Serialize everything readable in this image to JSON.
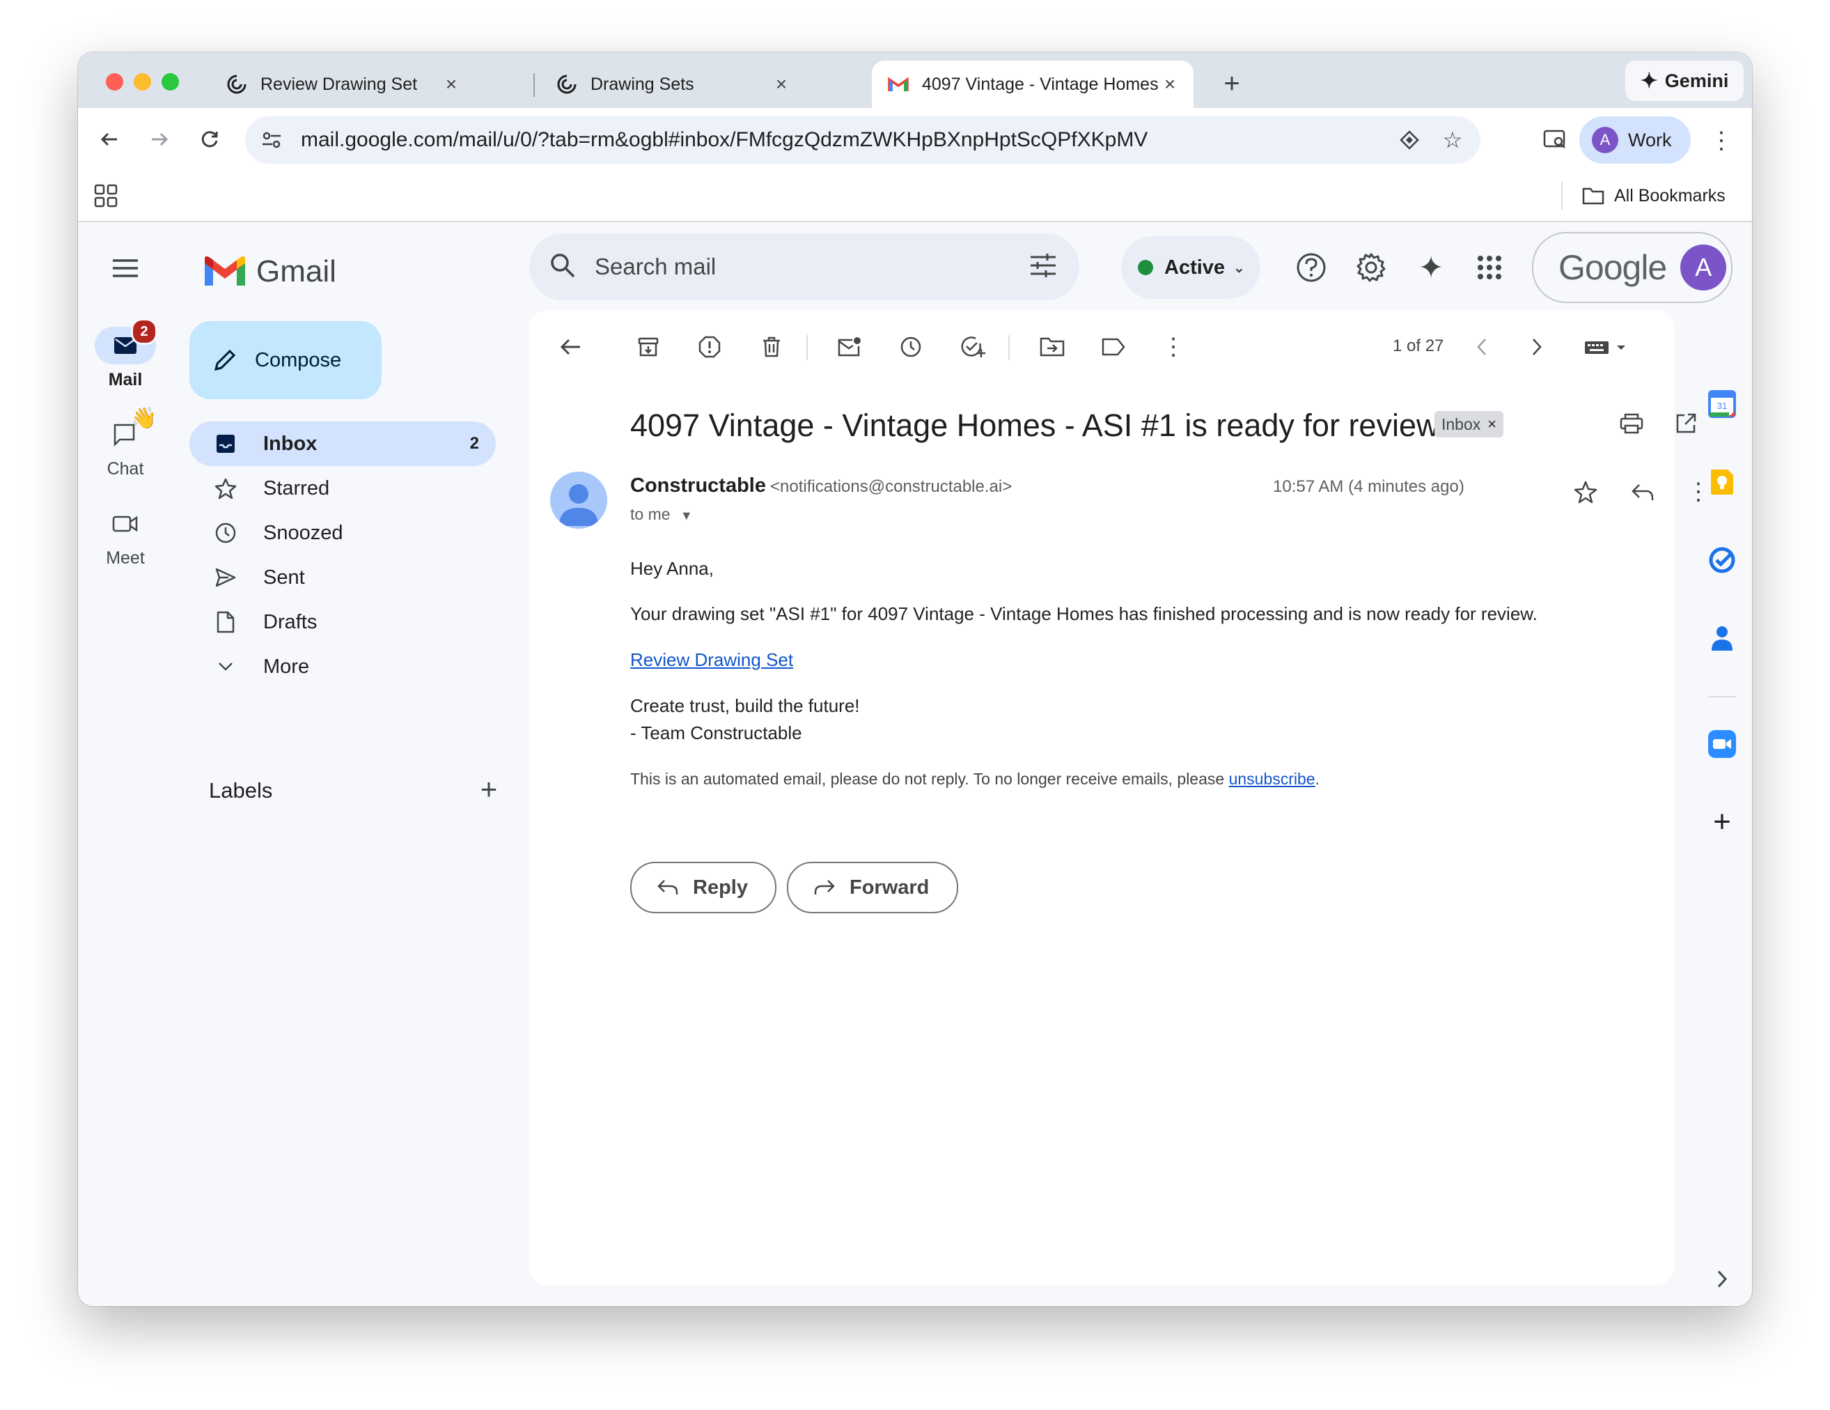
{
  "browser": {
    "tabs": [
      {
        "title": "Review Drawing Set",
        "icon": "constructable-icon",
        "active": false
      },
      {
        "title": "Drawing Sets",
        "icon": "constructable-icon",
        "active": false
      },
      {
        "title": "4097 Vintage - Vintage Homes - ASI #1 is ready for review",
        "icon": "gmail-icon",
        "active": true
      }
    ],
    "new_tab": "+",
    "gemini_label": "Gemini",
    "url": "mail.google.com/mail/u/0/?tab=rm&ogbl#inbox/FMfcgzQdzmZWKHpBXnpHptScQPfXKpMV",
    "profile_initial": "A",
    "profile_label": "Work",
    "bookmarks_label": "All Bookmarks"
  },
  "gmail": {
    "logo_text": "Gmail",
    "rail": [
      {
        "label": "Mail",
        "badge": "2",
        "icon": "mail-icon",
        "active": true
      },
      {
        "label": "Chat",
        "icon": "chat-icon",
        "active": false
      },
      {
        "label": "Meet",
        "icon": "video-icon",
        "active": false
      }
    ],
    "compose_label": "Compose",
    "nav": [
      {
        "label": "Inbox",
        "count": "2",
        "icon": "inbox-icon",
        "active": true
      },
      {
        "label": "Starred",
        "count": "",
        "icon": "star-icon",
        "active": false
      },
      {
        "label": "Snoozed",
        "count": "",
        "icon": "clock-icon",
        "active": false
      },
      {
        "label": "Sent",
        "count": "",
        "icon": "send-icon",
        "active": false
      },
      {
        "label": "Drafts",
        "count": "",
        "icon": "draft-icon",
        "active": false
      },
      {
        "label": "More",
        "count": "",
        "icon": "chevron-down-icon",
        "active": false
      }
    ],
    "labels_heading": "Labels",
    "search_placeholder": "Search mail",
    "status_label": "Active",
    "google_wordmark": "Google",
    "account_initial": "A",
    "pager": "1 of 27"
  },
  "message": {
    "subject": "4097 Vintage - Vintage Homes - ASI #1 is ready for review",
    "label_chip": "Inbox",
    "sender_name": "Constructable",
    "sender_email": "<notifications@constructable.ai>",
    "recipient": "to me",
    "time": "10:57 AM (4 minutes ago)",
    "greeting": "Hey Anna,",
    "paragraph": "Your drawing set \"ASI #1\" for 4097 Vintage - Vintage Homes has finished processing and is now ready for review.",
    "link_text": "Review Drawing Set",
    "signoff_1": "Create trust, build the future!",
    "signoff_2": "- Team Constructable",
    "footer_text": "This is an automated email, please do not reply. To no longer receive emails, please",
    "footer_link": "unsubscribe",
    "footer_end": ".",
    "reply_label": "Reply",
    "forward_label": "Forward"
  },
  "colors": {
    "accent_blue": "#d3e3fd",
    "compose_blue": "#c2e7ff",
    "link_blue": "#1155cc",
    "badge_red": "#b3261e",
    "active_green": "#1e8e3e"
  }
}
